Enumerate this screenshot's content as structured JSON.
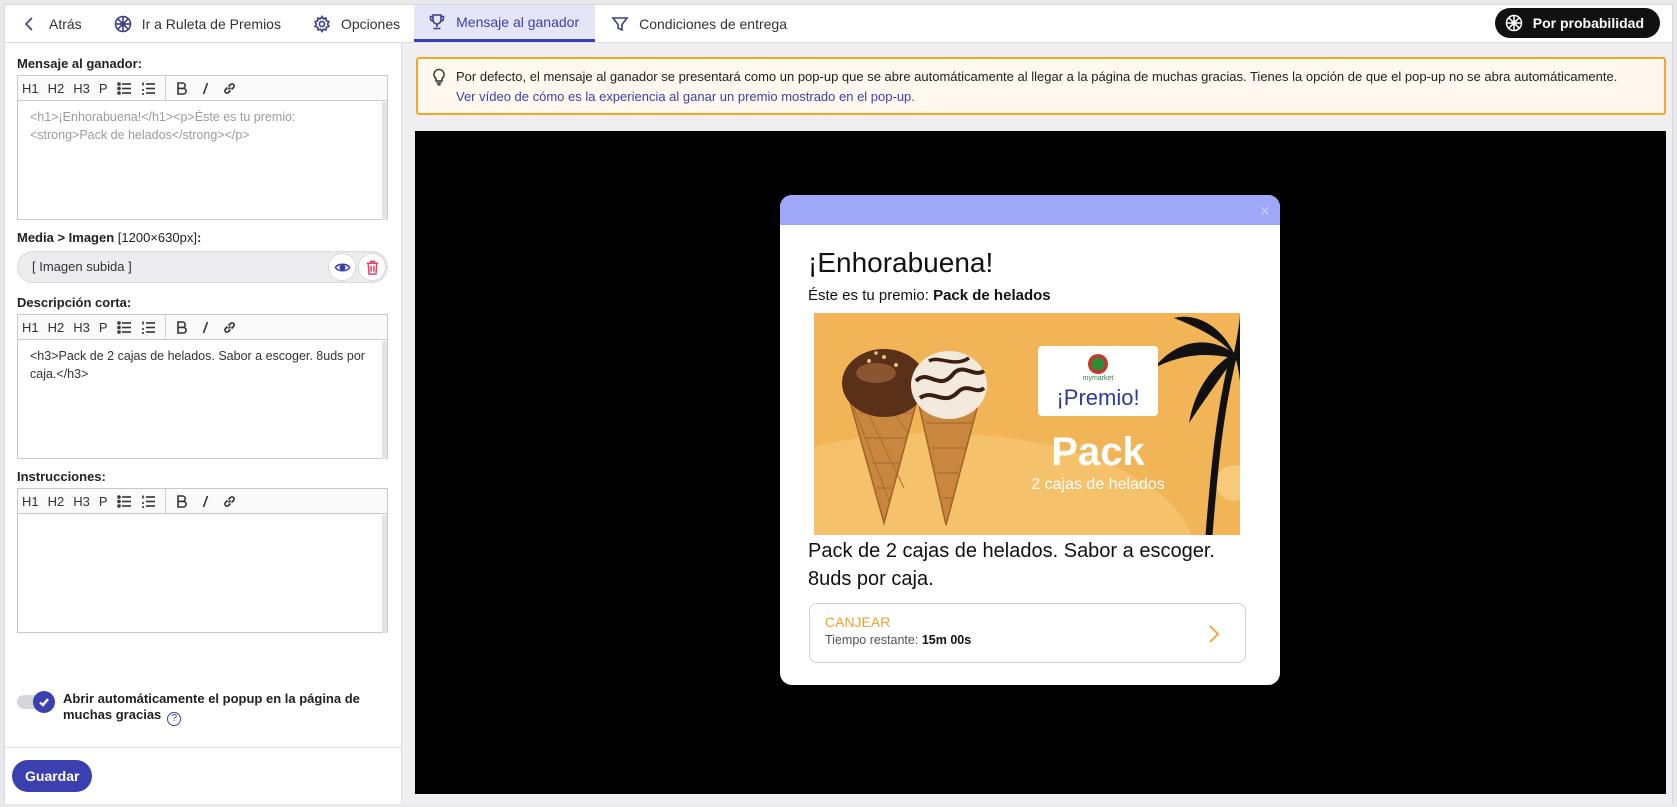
{
  "tabs": [
    {
      "label": "Atrás",
      "icon": "chevron-left-icon"
    },
    {
      "label": "Ir a Ruleta de Premios",
      "icon": "wheel-icon"
    },
    {
      "label": "Opciones",
      "icon": "gear-icon"
    },
    {
      "label": "Mensaje al ganador",
      "icon": "trophy-icon",
      "active": true
    },
    {
      "label": "Condiciones de entrega",
      "icon": "filter-icon"
    }
  ],
  "mode_button": {
    "label": "Por probabilidad",
    "icon": "wheel-icon"
  },
  "left": {
    "winner_message": {
      "label": "Mensaje al ganador:",
      "toolbar": [
        "H1",
        "H2",
        "H3",
        "P"
      ],
      "content": "<h1>¡Enhorabuena!</h1><p>Éste es tu premio: <strong>Pack de helados</strong></p>"
    },
    "media": {
      "label": "Media > Imagen",
      "size_hint": "[1200×630px]",
      "label_suffix": ":",
      "value": "[ Imagen subida ]"
    },
    "short_description": {
      "label": "Descripción corta:",
      "content": "<h3>Pack de 2 cajas de helados. Sabor a escoger. 8uds por caja.</h3>"
    },
    "instructions": {
      "label": "Instrucciones:",
      "content": ""
    },
    "auto_open": {
      "label": "Abrir automáticamente el popup en la página de muchas gracias",
      "checked": true,
      "help": "?"
    },
    "save_label": "Guardar"
  },
  "notice": {
    "text": "Por defecto, el mensaje al ganador se presentará como un pop-up que se abre automáticamente al llegar a la página de muchas gracias. Tienes la opción de que el pop-up no se abra automáticamente.",
    "link": "Ver vídeo de cómo es la experiencia al ganar un premio mostrado en el pop-up."
  },
  "popup": {
    "title": "¡Enhorabuena!",
    "prize_prefix": "Éste es tu premio:",
    "prize_name": "Pack de helados",
    "image": {
      "brand": "mymarket",
      "headline": "¡Premio!",
      "pack": "Pack",
      "subtitle": "2 cajas de helados"
    },
    "description": "Pack de 2 cajas de helados. Sabor a escoger. 8uds por caja.",
    "redeem_label": "CANJEAR",
    "timer_label": "Tiempo restante:",
    "timer_value": "15m 00s",
    "close": "×"
  },
  "colors": {
    "accent": "#3c3fb0",
    "notice_border": "#f5a623",
    "popup_header": "#9fa8f8",
    "redeem": "#f0a030"
  }
}
